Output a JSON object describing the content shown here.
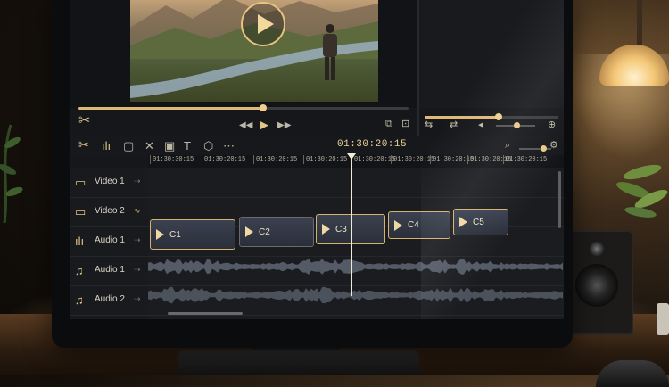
{
  "transport": {
    "progress_left": 0.56,
    "progress_right": 0.55
  },
  "timecode": "01:30:20:15",
  "ruler_ticks": [
    "01:30:30:15",
    "01:30:20:15",
    "01:30:20:15",
    "01:30:20:15",
    "01:30:20:15",
    "01:30:20:15",
    "01:30:20:15",
    "01:30:20:15",
    "01:30:20:15"
  ],
  "tracks": [
    {
      "name": "Video 1",
      "icon": "video-camera-icon"
    },
    {
      "name": "Video 2",
      "icon": "video-frame-icon"
    },
    {
      "name": "Audio 1",
      "icon": "audio-bars-icon"
    },
    {
      "name": "Audio 1",
      "icon": "music-note-icon"
    },
    {
      "name": "Audio 2",
      "icon": "music-note-icon"
    }
  ],
  "clips": [
    "C1",
    "C2",
    "C3",
    "C4",
    "C5"
  ],
  "colors": {
    "accent": "#e0b979",
    "clip_border": "#d6b270",
    "background": "#15171b"
  }
}
